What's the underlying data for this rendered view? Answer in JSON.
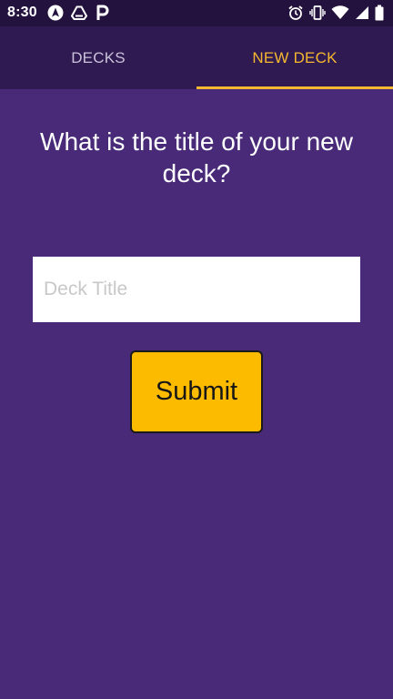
{
  "status_bar": {
    "time": "8:30",
    "left_icons": [
      "navigation-app-icon",
      "drive-app-icon",
      "parking-app-icon"
    ],
    "right_icons": [
      "alarm-icon",
      "vibrate-icon",
      "wifi-icon",
      "cell-signal-icon",
      "battery-icon"
    ]
  },
  "tabs": {
    "decks_label": "DECKS",
    "new_deck_label": "NEW DECK",
    "active": "NEW DECK"
  },
  "form": {
    "question": "What is the title of your new deck?",
    "input_placeholder": "Deck Title",
    "input_value": "",
    "submit_label": "Submit"
  },
  "colors": {
    "status_bar": "#23123d",
    "tab_bar": "#2f1a52",
    "background": "#482a78",
    "accent": "#f5b82e",
    "button": "#fdbb00"
  }
}
